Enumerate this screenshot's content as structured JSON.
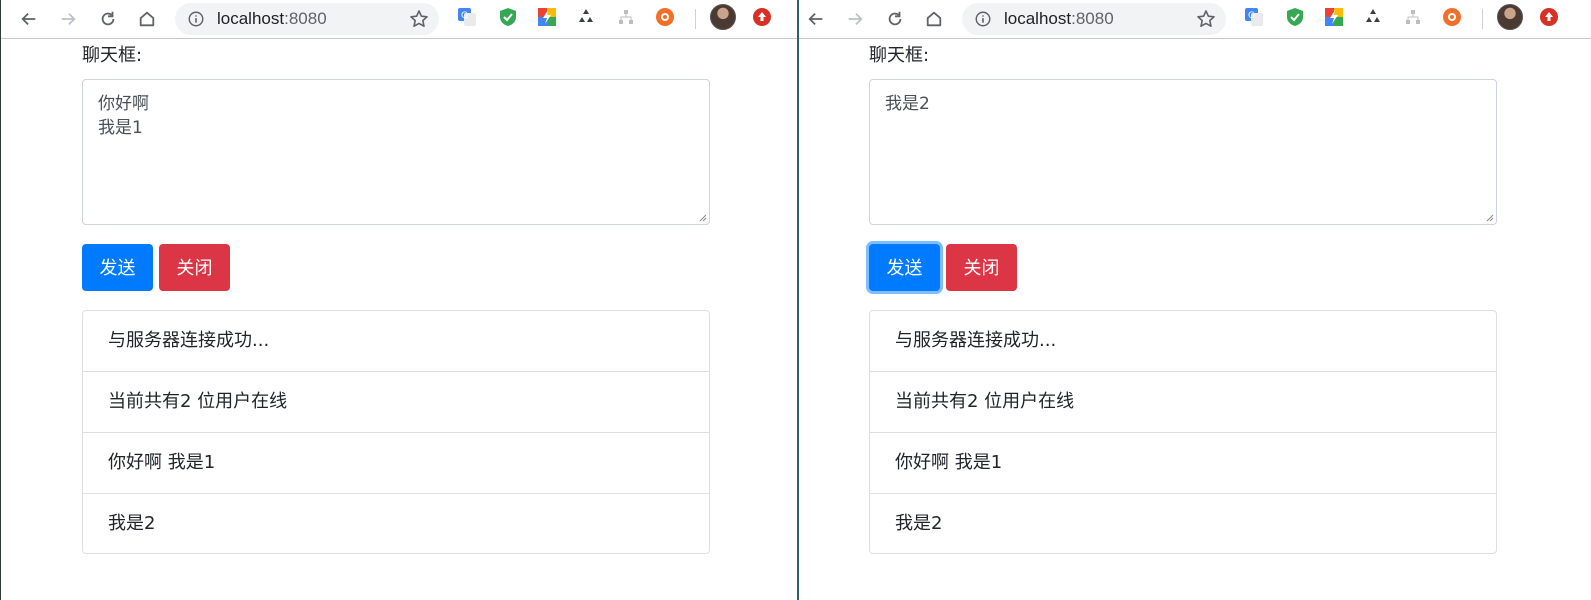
{
  "windows": [
    {
      "url_host": "localhost",
      "url_port": ":8080",
      "chat_label": "聊天框:",
      "textarea_value": "你好啊\n我是1",
      "send_label": "发送",
      "close_label": "关闭",
      "messages": [
        "与服务器连接成功...",
        "当前共有2 位用户在线",
        "你好啊 我是1",
        "我是2"
      ]
    },
    {
      "url_host": "localhost",
      "url_port": ":8080",
      "chat_label": "聊天框:",
      "textarea_value": "我是2",
      "send_label": "发送",
      "close_label": "关闭",
      "messages": [
        "与服务器连接成功...",
        "当前共有2 位用户在线",
        "你好啊 我是1",
        "我是2"
      ]
    }
  ],
  "colors": {
    "primary": "#007bff",
    "danger": "#dc3545",
    "border": "#dfdfdf"
  },
  "icons": [
    "back-icon",
    "forward-icon",
    "reload-icon",
    "home-icon",
    "info-icon",
    "bookmark-star-icon",
    "translate-extension-icon",
    "shield-extension-icon",
    "lightning-extension-icon",
    "recycle-extension-icon",
    "sitemap-extension-icon",
    "lifebuoy-extension-icon",
    "profile-avatar",
    "update-icon"
  ]
}
